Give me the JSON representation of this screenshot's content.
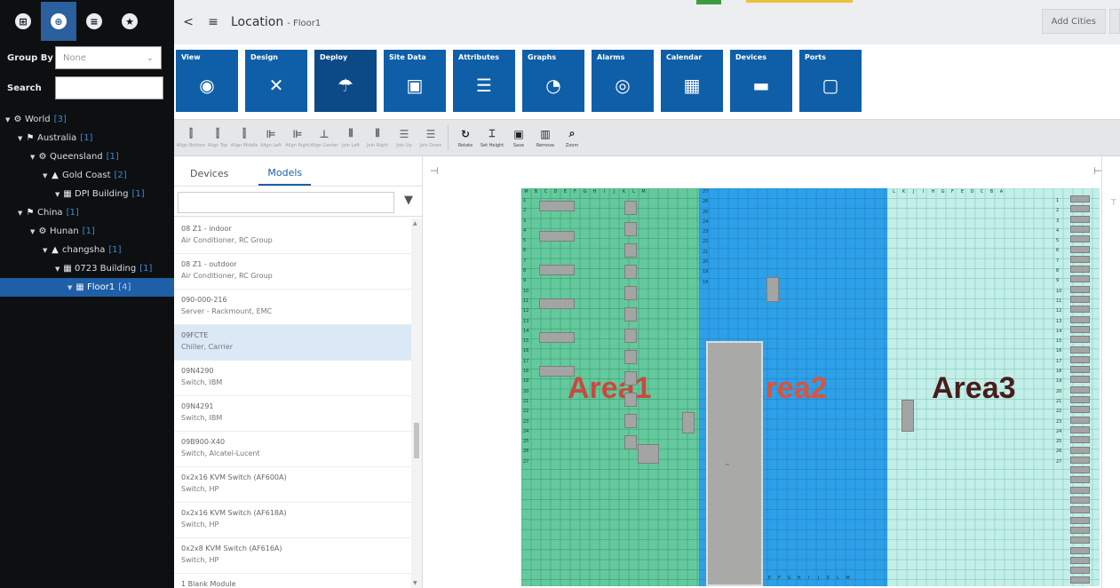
{
  "sidebar": {
    "top_icons": [
      {
        "name": "apps-icon",
        "glyph": "⊞"
      },
      {
        "name": "globe-icon",
        "glyph": "⊕"
      },
      {
        "name": "list-icon",
        "glyph": "≡"
      },
      {
        "name": "star-icon",
        "glyph": "★"
      }
    ],
    "group_by_label": "Group By",
    "group_by_value": "None",
    "search_label": "Search",
    "tree": [
      {
        "name": "World",
        "count": "[3]",
        "icon": "⚙",
        "level": 0
      },
      {
        "name": "Australia",
        "count": "[1]",
        "icon": "⚑",
        "level": 1
      },
      {
        "name": "Queensland",
        "count": "[1]",
        "icon": "⚙",
        "level": 2
      },
      {
        "name": "Gold Coast",
        "count": "[2]",
        "icon": "▲",
        "level": 3
      },
      {
        "name": "DPI Building",
        "count": "[1]",
        "icon": "▦",
        "level": 4
      },
      {
        "name": "China",
        "count": "[1]",
        "icon": "⚑",
        "level": 1
      },
      {
        "name": "Hunan",
        "count": "[1]",
        "icon": "⚙",
        "level": 2
      },
      {
        "name": "changsha",
        "count": "[1]",
        "icon": "▲",
        "level": 3
      },
      {
        "name": "0723 Building",
        "count": "[1]",
        "icon": "▦",
        "level": 4
      },
      {
        "name": "Floor1",
        "count": "[4]",
        "icon": "▦",
        "level": 5,
        "selected": true
      }
    ]
  },
  "header": {
    "title": "Location",
    "subtitle": "- Floor1",
    "back_glyph": "<",
    "menu_glyph": "≡",
    "add_cities_label": "Add Cities"
  },
  "ribbon": {
    "tiles": [
      {
        "label": "View",
        "glyph": "◉",
        "icon": "eye-icon",
        "active": false
      },
      {
        "label": "Design",
        "glyph": "✕",
        "icon": "tools-icon",
        "active": false
      },
      {
        "label": "Deploy",
        "glyph": "☂",
        "icon": "parachute-icon",
        "active": true
      },
      {
        "label": "Site Data",
        "glyph": "▣",
        "icon": "monitor-chart-icon",
        "active": false
      },
      {
        "label": "Attributes",
        "glyph": "☰",
        "icon": "list-document-icon",
        "active": false
      },
      {
        "label": "Graphs",
        "glyph": "◔",
        "icon": "gauge-icon",
        "active": false
      },
      {
        "label": "Alarms",
        "glyph": "◎",
        "icon": "alarm-icon",
        "active": false
      },
      {
        "label": "Calendar",
        "glyph": "▦",
        "icon": "calendar-icon",
        "active": false
      },
      {
        "label": "Devices",
        "glyph": "▬",
        "icon": "device-icon",
        "active": false
      },
      {
        "label": "Ports",
        "glyph": "▢",
        "icon": "port-icon",
        "active": false
      }
    ]
  },
  "toolbar": {
    "tools": [
      {
        "label": "Align Bottom",
        "glyph": "⫿",
        "dark": false
      },
      {
        "label": "Align Top",
        "glyph": "⫿",
        "dark": false
      },
      {
        "label": "Align Middle",
        "glyph": "⫿",
        "dark": false
      },
      {
        "label": "Align Left",
        "glyph": "⊫",
        "dark": false
      },
      {
        "label": "Align Right",
        "glyph": "⊫",
        "dark": false
      },
      {
        "label": "Align Center",
        "glyph": "⊥",
        "dark": false
      },
      {
        "label": "Join Left",
        "glyph": "⦀",
        "dark": false
      },
      {
        "label": "Join Right",
        "glyph": "⦀",
        "dark": false
      },
      {
        "label": "Join Up",
        "glyph": "☰",
        "dark": false
      },
      {
        "label": "Join Down",
        "glyph": "☰",
        "dark": false
      },
      {
        "label": "Rotate",
        "glyph": "↻",
        "dark": true
      },
      {
        "label": "Set Height",
        "glyph": "⌶",
        "dark": true
      },
      {
        "label": "Save",
        "glyph": "▣",
        "dark": true
      },
      {
        "label": "Remove",
        "glyph": "▥",
        "dark": true
      },
      {
        "label": "Zoom",
        "glyph": "⌕",
        "dark": true
      }
    ]
  },
  "panel": {
    "tabs": [
      "Devices",
      "Models"
    ],
    "active_tab": 1,
    "models": [
      {
        "name": "08 Z1 - indoor",
        "type": "Air Conditioner, RC Group"
      },
      {
        "name": "08 Z1 - outdoor",
        "type": "Air Conditioner, RC Group"
      },
      {
        "name": "090-000-216",
        "type": "Server - Rackmount, EMC"
      },
      {
        "name": "09FCTE",
        "type": "Chiller, Carrier",
        "selected": true
      },
      {
        "name": "09N4290",
        "type": "Switch, IBM"
      },
      {
        "name": "09N4291",
        "type": "Switch, IBM"
      },
      {
        "name": "09B900-X40",
        "type": "Switch, Alcatel-Lucent"
      },
      {
        "name": "0x2x16 KVM Switch (AF600A)",
        "type": "Switch, HP"
      },
      {
        "name": "0x2x16 KVM Switch (AF618A)",
        "type": "Switch, HP"
      },
      {
        "name": "0x2x8 KVM Switch (AF616A)",
        "type": "Switch, HP"
      },
      {
        "name": "1 Blank Module",
        "type": ""
      }
    ]
  },
  "floor": {
    "areas": [
      {
        "name": "Area1",
        "color": "#64c99d"
      },
      {
        "name": "Area2",
        "color": "#2ea0e8"
      },
      {
        "name": "Area3",
        "color": "#c3efe8"
      }
    ],
    "area1_cols": [
      "M",
      "B",
      "C",
      "D",
      "E",
      "F",
      "G",
      "H",
      "I",
      "J",
      "K",
      "L",
      "M"
    ],
    "area3_cols": [
      "L",
      "K",
      "J",
      "I",
      "H",
      "G",
      "F",
      "E",
      "D",
      "C",
      "B",
      "A"
    ],
    "area2_bottom_cols": [
      "E",
      "F",
      "G",
      "H",
      "I",
      "J",
      "K",
      "L",
      "M"
    ],
    "area1_rows": [
      "1",
      "2",
      "3",
      "4",
      "5",
      "6",
      "7",
      "8",
      "9",
      "10",
      "11",
      "12",
      "13",
      "14",
      "15",
      "16",
      "17",
      "18",
      "19",
      "20",
      "21",
      "22",
      "23",
      "24",
      "25",
      "26",
      "27"
    ],
    "area2_rows": [
      "27",
      "26",
      "25",
      "24",
      "23",
      "22",
      "21",
      "20",
      "19",
      "18"
    ],
    "area3_rows": [
      "1",
      "2",
      "3",
      "4",
      "5",
      "6",
      "7",
      "8",
      "9",
      "10",
      "11",
      "12",
      "13",
      "14",
      "15",
      "16",
      "17",
      "18",
      "19",
      "20",
      "21",
      "22",
      "23",
      "24",
      "25",
      "26",
      "27"
    ]
  }
}
